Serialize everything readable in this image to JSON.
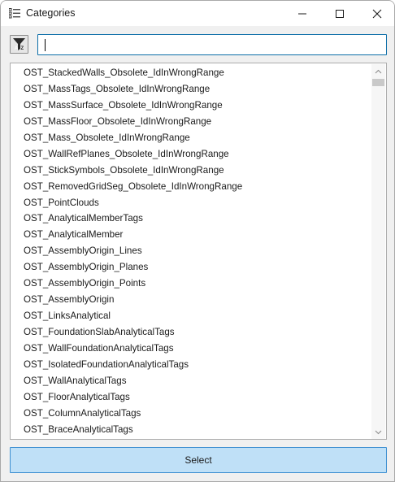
{
  "window": {
    "title": "Categories",
    "icon": "list-icon"
  },
  "toolbar": {
    "sort_icon": "sort-az-filter-icon",
    "search": {
      "value": "",
      "placeholder": ""
    }
  },
  "list": {
    "items": [
      "OST_StackedWalls_Obsolete_IdInWrongRange",
      "OST_MassTags_Obsolete_IdInWrongRange",
      "OST_MassSurface_Obsolete_IdInWrongRange",
      "OST_MassFloor_Obsolete_IdInWrongRange",
      "OST_Mass_Obsolete_IdInWrongRange",
      "OST_WallRefPlanes_Obsolete_IdInWrongRange",
      "OST_StickSymbols_Obsolete_IdInWrongRange",
      "OST_RemovedGridSeg_Obsolete_IdInWrongRange",
      "OST_PointClouds",
      "OST_AnalyticalMemberTags",
      "OST_AnalyticalMember",
      "OST_AssemblyOrigin_Lines",
      "OST_AssemblyOrigin_Planes",
      "OST_AssemblyOrigin_Points",
      "OST_AssemblyOrigin",
      "OST_LinksAnalytical",
      "OST_FoundationSlabAnalyticalTags",
      "OST_WallFoundationAnalyticalTags",
      "OST_IsolatedFoundationAnalyticalTags",
      "OST_WallAnalyticalTags",
      "OST_FloorAnalyticalTags",
      "OST_ColumnAnalyticalTags",
      "OST_BraceAnalyticalTags"
    ]
  },
  "footer": {
    "select_label": "Select"
  },
  "colors": {
    "select_button_bg": "#bfe0f7",
    "select_button_border": "#3d8fd1",
    "search_border": "#0c6ea8"
  }
}
